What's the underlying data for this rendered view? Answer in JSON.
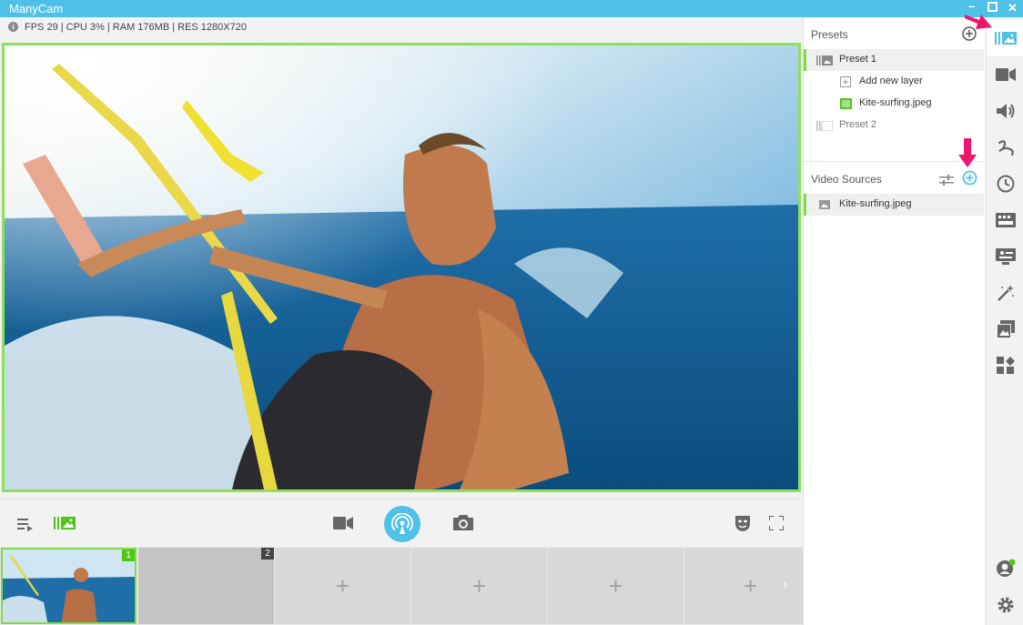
{
  "app": {
    "title": "ManyCam"
  },
  "window": {
    "minimize": "–",
    "maximize": "□",
    "close": "✕"
  },
  "stats": {
    "text": "FPS 29 | CPU 3% | RAM 176MB | RES 1280X720",
    "info_icon": "i"
  },
  "controls": {
    "left": [
      "playlist-icon",
      "presets-layers-icon"
    ],
    "center": [
      "video-camera-icon",
      "broadcast-icon",
      "snapshot-camera-icon"
    ],
    "right": [
      "mask-icon",
      "fullscreen-icon"
    ]
  },
  "thumbnails": [
    {
      "number": "1",
      "has_image": true,
      "active": true
    },
    {
      "number": "2",
      "has_image": false,
      "active": false
    },
    {
      "plus": "+"
    },
    {
      "plus": "+"
    },
    {
      "plus": "+"
    },
    {
      "plus": "+"
    }
  ],
  "thumb_next": "›",
  "presets": {
    "header": "Presets",
    "items": [
      {
        "label": "Preset 1",
        "selected": true
      },
      {
        "label": "Add new layer"
      },
      {
        "label": "Kite-surfing.jpeg"
      },
      {
        "label": "Preset 2",
        "selected": false
      }
    ]
  },
  "video_sources": {
    "header": "Video Sources",
    "items": [
      {
        "label": "Kite-surfing.jpeg",
        "selected": true
      }
    ]
  },
  "sidebar_icons": [
    "presets-icon",
    "video-icon",
    "audio-icon",
    "drawing-icon",
    "clock-icon",
    "lower-thirds-icon",
    "chroma-icon",
    "effects-wand-icon",
    "images-icon",
    "widgets-icon"
  ],
  "colors": {
    "accent": "#4fc1e9",
    "active_green": "#7fdc45",
    "arrow_pink": "#f0146c"
  }
}
